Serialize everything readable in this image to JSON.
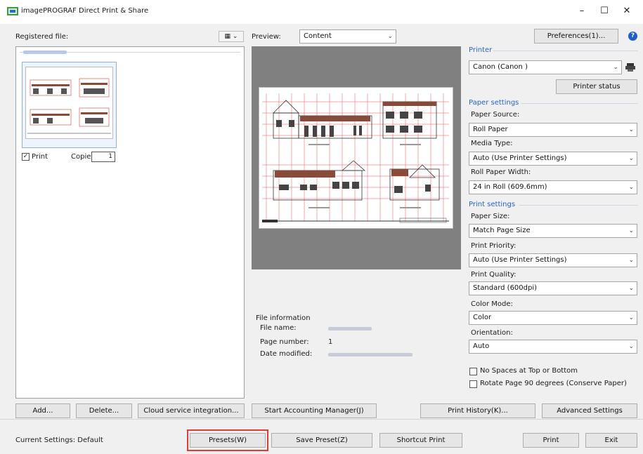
{
  "window": {
    "title": "imagePROGRAF Direct Print & Share",
    "minimize_glyph": "–",
    "maximize_glyph": "☐",
    "close_glyph": "✕"
  },
  "registered": {
    "label": "Registered file:",
    "view_glyph": "▦ ⌄",
    "print_label": "Print",
    "print_checked": "✓",
    "copies_label": "Copies",
    "copies_value": "1"
  },
  "preview": {
    "label": "Preview:",
    "mode": "Content"
  },
  "file_info": {
    "title": "File information",
    "name_label": "File name:",
    "page_label": "Page number:",
    "page_value": "1",
    "date_label": "Date modified:"
  },
  "toolbar": {
    "preferences": "Preferences(1)...",
    "help_glyph": "?"
  },
  "printer": {
    "section": "Printer",
    "name": "Canon (Canon )",
    "status_button": "Printer status"
  },
  "paper_settings": {
    "section": "Paper settings",
    "source_label": "Paper Source:",
    "source_value": "Roll Paper",
    "media_label": "Media Type:",
    "media_value": "Auto (Use Printer Settings)",
    "width_label": "Roll Paper Width:",
    "width_value": "24 in Roll (609.6mm)"
  },
  "print_settings": {
    "section": "Print settings",
    "size_label": "Paper Size:",
    "size_value": "Match Page Size",
    "priority_label": "Print Priority:",
    "priority_value": "Auto (Use Printer Settings)",
    "quality_label": "Print Quality:",
    "quality_value": "Standard (600dpi)",
    "color_label": "Color Mode:",
    "color_value": "Color",
    "orientation_label": "Orientation:",
    "orientation_value": "Auto",
    "no_spaces_label": "No Spaces at Top or Bottom",
    "rotate_label": "Rotate Page 90 degrees (Conserve Paper)"
  },
  "actions": {
    "add": "Add...",
    "delete": "Delete...",
    "cloud": "Cloud service integration...",
    "accounting": "Start Accounting Manager(J)",
    "history": "Print History(K)...",
    "advanced": "Advanced Settings"
  },
  "footer": {
    "current_settings": "Current Settings: Default",
    "presets": "Presets(W)",
    "save_preset": "Save Preset(Z)",
    "shortcut": "Shortcut Print",
    "print": "Print",
    "exit": "Exit"
  },
  "colors": {
    "accent_blue": "#2a64c7",
    "highlight_red": "#e53a3a",
    "preview_gray": "#808080"
  }
}
